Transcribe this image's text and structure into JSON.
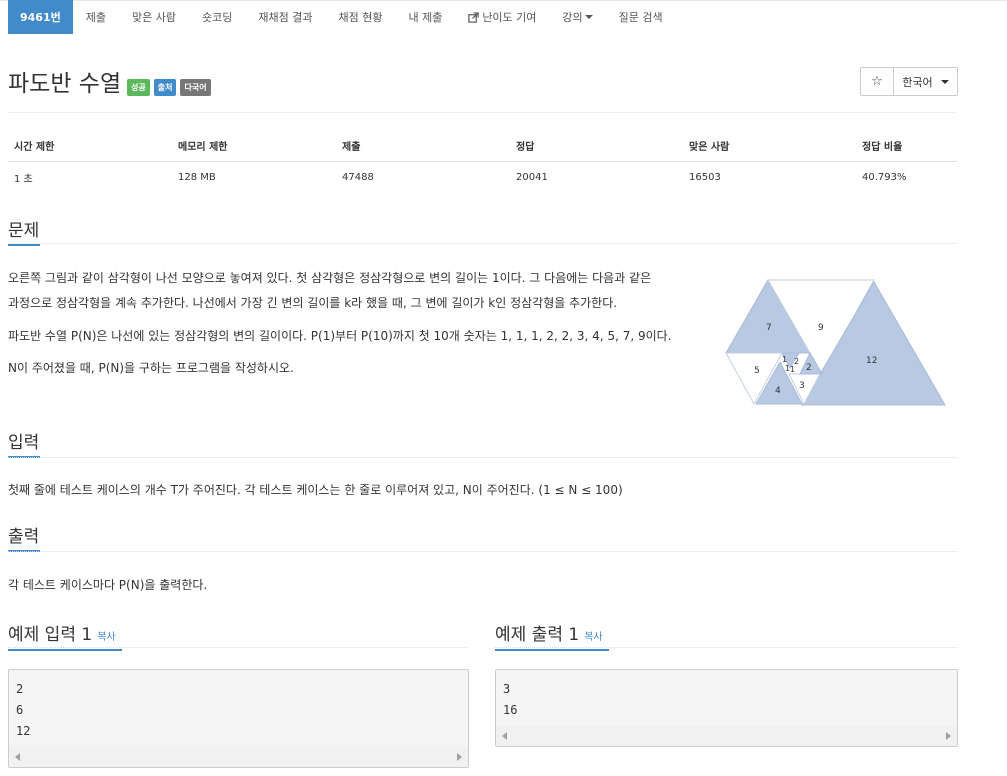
{
  "nav": {
    "tabs": [
      {
        "label": "9461번"
      },
      {
        "label": "제출"
      },
      {
        "label": "맞은 사람"
      },
      {
        "label": "숏코딩"
      },
      {
        "label": "재채점 결과"
      },
      {
        "label": "채점 현황"
      },
      {
        "label": "내 제출"
      },
      {
        "label": "난이도 기여"
      },
      {
        "label": "강의"
      },
      {
        "label": "질문 검색"
      }
    ]
  },
  "problem": {
    "title": "파도반 수열",
    "badges": [
      "성공",
      "출처",
      "다국어"
    ],
    "language": "한국어",
    "star": "☆"
  },
  "info": {
    "headers": [
      "시간 제한",
      "메모리 제한",
      "제출",
      "정답",
      "맞은 사람",
      "정답 비율"
    ],
    "values": [
      "1 초",
      "128 MB",
      "47488",
      "20041",
      "16503",
      "40.793%"
    ]
  },
  "sections": {
    "problem_title": "문제",
    "problem_lines": [
      "오른쪽 그림과 같이 삼각형이 나선 모양으로 놓여져 있다. 첫 삼각형은 정삼각형으로 변의 길이는 1이다. 그 다음에는 다음과 같은",
      "과정으로 정삼각형을 계속 추가한다. 나선에서 가장 긴 변의 길이를 k라 했을 때, 그 변에 길이가 k인 정삼각형을 추가한다.",
      "파도반 수열 P(N)은 나선에 있는 정삼각형의 변의 길이이다. P(1)부터 P(10)까지 첫 10개 숫자는 1, 1, 1, 2, 2, 3, 4, 5, 7, 9이다.",
      "N이 주어졌을 때, P(N)을 구하는 프로그램을 작성하시오."
    ],
    "input_title": "입력",
    "input_text": "첫째 줄에 테스트 케이스의 개수 T가 주어진다. 각 테스트 케이스는 한 줄로 이루어져 있고, N이 주어진다. (1 ≤ N ≤ 100)",
    "output_title": "출력",
    "output_text": "각 테스트 케이스마다 P(N)을 출력한다."
  },
  "diagram": {
    "labels": {
      "t7": "7",
      "t9": "9",
      "t12": "12",
      "t5": "5",
      "t4": "4",
      "t3": "3",
      "t2": "2",
      "a1": "1",
      "b2": "2",
      "c1": "1",
      "d1": "1"
    },
    "fill": "#b8c9e4",
    "stroke": "#a9bad6"
  },
  "examples": {
    "input_title": "예제 입력 1",
    "output_title": "예제 출력 1",
    "copy_label": "복사",
    "input_lines": [
      "2",
      "6",
      "12"
    ],
    "output_lines": [
      "3",
      "16"
    ]
  }
}
